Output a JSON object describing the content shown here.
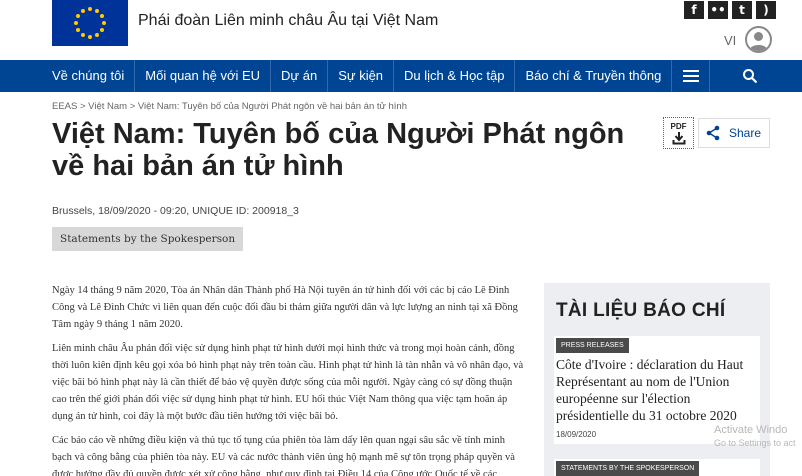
{
  "header": {
    "site_title": "Phái đoàn Liên minh châu Âu tại Việt Nam",
    "language": "VI",
    "social": [
      {
        "icon": "facebook-icon",
        "glyph": "f"
      },
      {
        "icon": "flickr-icon",
        "glyph": "••"
      },
      {
        "icon": "twitter-icon",
        "glyph": "t"
      },
      {
        "icon": "rss-icon",
        "glyph": ")"
      }
    ]
  },
  "nav": {
    "items": [
      "Về chúng tôi",
      "Mối quan hệ với EU",
      "Dự án",
      "Sự kiện",
      "Du lịch & Học tập",
      "Báo chí & Truyền thông"
    ]
  },
  "breadcrumb": "EEAS > Việt Nam > Việt Nam: Tuyên bố của Người Phát ngôn về hai bản án tử hình",
  "article": {
    "title": "Việt Nam: Tuyên bố của Người Phát ngôn về hai bản án tử hình",
    "meta": "Brussels, 18/09/2020 - 09:20, UNIQUE ID: 200918_3",
    "tag": "Statements by the Spokesperson",
    "pdf_label": "PDF",
    "share_label": "Share",
    "paragraphs": [
      "Ngày 14 tháng 9 năm 2020, Tòa án Nhân dân Thành phố Hà Nội tuyên án tử hình đối với các bị cáo Lê Đình Công và Lê Đình Chức vì liên quan đến cuộc đối đầu bi thảm giữa người dân và lực lượng an ninh tại xã Đồng Tâm ngày 9 tháng 1 năm 2020.",
      "Liên minh châu Âu phản đối việc sử dụng hình phạt tử hình dưới mọi hình thức và trong mọi hoàn cảnh, đồng thời luôn kiên định kêu gọi xóa bỏ hình phạt này trên toàn cầu. Hình phạt tử hình là tàn nhẫn và vô nhân đạo, và việc bãi bỏ hình phạt này là cần thiết để bảo vệ quyền được sống của mỗi người.  Ngày càng có sự đồng thuận cao trên thế giới phản đối việc sử dụng hình phạt tử hình. EU hối thúc Việt Nam thông qua việc tạm hoãn áp dụng án tử hình, coi đây là một bước đầu tiên hướng tới việc bãi bỏ.",
      "Các báo cáo về những điều kiện và thủ tục tố tụng của phiên tòa làm dấy lên quan ngại sâu sắc về tính minh bạch và công bằng của phiên tòa này. EU và các nước thành viên ủng hộ mạnh mẽ sự tôn trọng pháp quyền và được hưởng đầy đủ quyền được xét xử công bằng, như quy định tại Điều 14 của Công ước Quốc tế về các"
    ]
  },
  "sidebar": {
    "heading": "TÀI LIỆU BÁO CHÍ",
    "cards": [
      {
        "tag": "PRESS RELEASES",
        "title": "Côte d'Ivoire : déclaration du Haut Représentant au nom de l'Union européenne sur l'élection présidentielle du 31 octobre 2020",
        "date": "18/09/2020"
      },
      {
        "tag": "STATEMENTS BY THE SPOKESPERSON",
        "title": "",
        "date": ""
      }
    ]
  },
  "watermark": {
    "line1": "Activate Windo",
    "line2": "Go to Settings to act"
  },
  "colors": {
    "nav_blue": "#004494",
    "eu_blue": "#003399",
    "eu_gold": "#FFCC00",
    "sidebar_bg": "#eceef1",
    "tag_bg": "#d8d8d8"
  }
}
